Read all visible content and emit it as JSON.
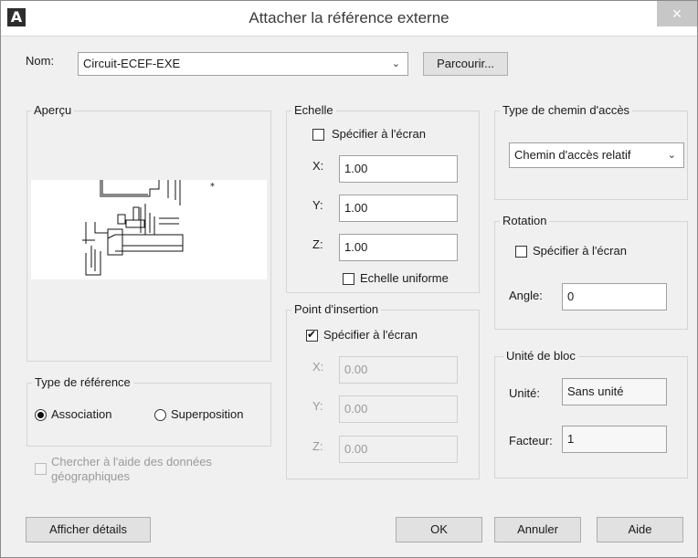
{
  "window": {
    "title": "Attacher la référence externe",
    "close_glyph": "×",
    "app_glyph": "A"
  },
  "name": {
    "label": "Nom:",
    "value": "Circuit-ECEF-EXE",
    "browse_label": "Parcourir..."
  },
  "preview": {
    "label": "Aperçu"
  },
  "scale": {
    "label": "Echelle",
    "specify_label": "Spécifier à l'écran",
    "specify_checked": false,
    "x_label": "X:",
    "x_value": "1.00",
    "y_label": "Y:",
    "y_value": "1.00",
    "z_label": "Z:",
    "z_value": "1.00",
    "uniform_label": "Echelle uniforme",
    "uniform_checked": false
  },
  "path_type": {
    "label": "Type de chemin d'accès",
    "value": "Chemin d'accès relatif"
  },
  "rotation": {
    "label": "Rotation",
    "specify_label": "Spécifier à l'écran",
    "angle_label": "Angle:",
    "angle_value": "0"
  },
  "insertion": {
    "label": "Point d'insertion",
    "specify_label": "Spécifier à l'écran",
    "specify_checked": true,
    "x_label": "X:",
    "x_value": "0.00",
    "y_label": "Y:",
    "y_value": "0.00",
    "z_label": "Z:",
    "z_value": "0.00"
  },
  "block_unit": {
    "label": "Unité de bloc",
    "unit_label": "Unité:",
    "unit_value": "Sans unité",
    "factor_label": "Facteur:",
    "factor_value": "1"
  },
  "reference_type": {
    "label": "Type de référence",
    "attach_label": "Association",
    "overlay_label": "Superposition",
    "selected": "Association"
  },
  "geo": {
    "label_line1": "Chercher à l'aide des données",
    "label_line2": "géographiques"
  },
  "buttons": {
    "details": "Afficher détails",
    "ok": "OK",
    "cancel": "Annuler",
    "help": "Aide"
  }
}
